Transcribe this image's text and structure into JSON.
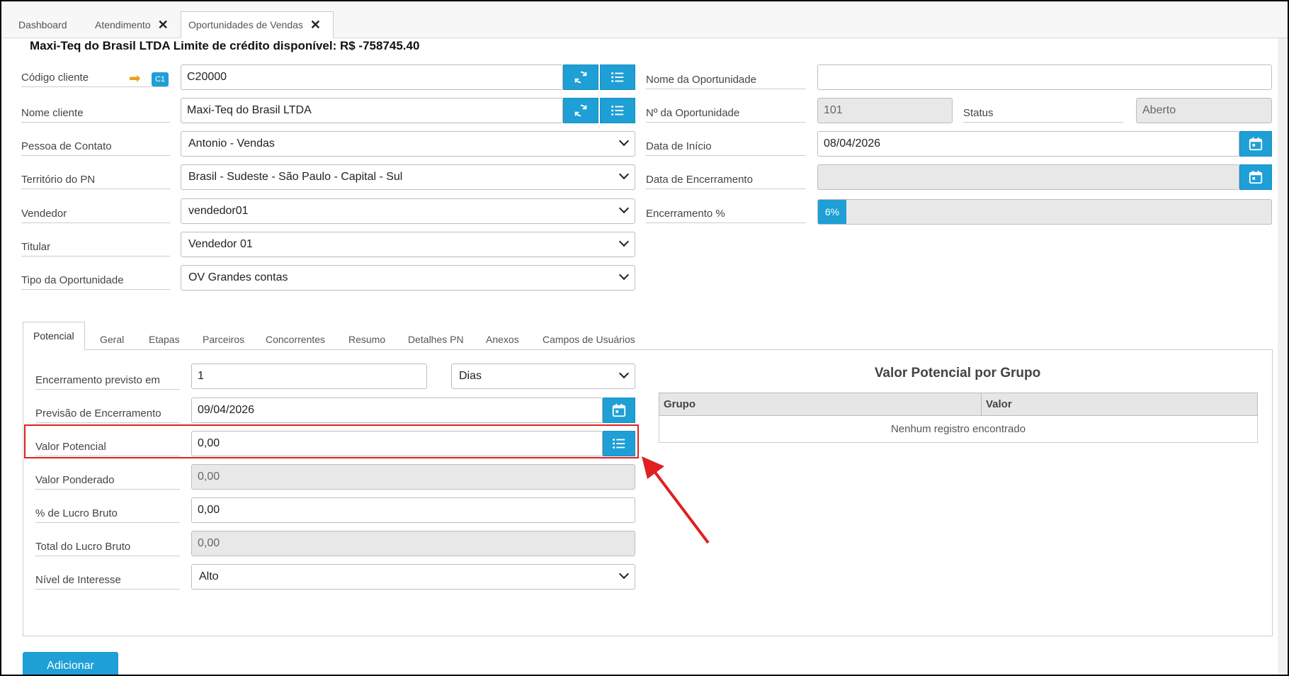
{
  "tabs": [
    {
      "label": "Dashboard"
    },
    {
      "label": "Atendimento"
    },
    {
      "label": "Oportunidades de Vendas"
    }
  ],
  "header": {
    "text": "Maxi-Teq do Brasil LTDA Limite de crédito disponível: R$ -758745.40"
  },
  "left_form": {
    "codigo_cliente": {
      "label": "Código cliente",
      "badge": "C1",
      "value": "C20000"
    },
    "nome_cliente": {
      "label": "Nome cliente",
      "value": "Maxi-Teq do Brasil LTDA"
    },
    "pessoa_contato": {
      "label": "Pessoa de Contato",
      "value": "Antonio - Vendas"
    },
    "territorio": {
      "label": "Território do PN",
      "value": "Brasil - Sudeste - São Paulo - Capital - Sul"
    },
    "vendedor": {
      "label": "Vendedor",
      "value": "vendedor01"
    },
    "titular": {
      "label": "Titular",
      "value": "Vendedor 01"
    },
    "tipo": {
      "label": "Tipo da Oportunidade",
      "value": "OV Grandes contas"
    }
  },
  "right_form": {
    "nome_oportunidade": {
      "label": "Nome da Oportunidade",
      "value": ""
    },
    "num_oportunidade": {
      "label": "Nº da Oportunidade",
      "value": "101"
    },
    "status": {
      "label": "Status",
      "value": "Aberto"
    },
    "data_inicio": {
      "label": "Data de Início",
      "value": "08/04/2026"
    },
    "data_encerramento": {
      "label": "Data de Encerramento",
      "value": ""
    },
    "encerramento_pct": {
      "label": "Encerramento %",
      "value": "6%",
      "fraction": 0.06
    }
  },
  "panel_tabs": [
    "Potencial",
    "Geral",
    "Etapas",
    "Parceiros",
    "Concorrentes",
    "Resumo",
    "Detalhes PN",
    "Anexos",
    "Campos de Usuários"
  ],
  "potencial": {
    "encerramento_previsto": {
      "label": "Encerramento previsto em",
      "value": "1",
      "unit": "Dias"
    },
    "previsao_encerramento": {
      "label": "Previsão de Encerramento",
      "value": "09/04/2026"
    },
    "valor_potencial": {
      "label": "Valor Potencial",
      "value": "0,00"
    },
    "valor_ponderado": {
      "label": "Valor Ponderado",
      "value": "0,00"
    },
    "lucro_bruto_pct": {
      "label": "% de Lucro Bruto",
      "value": "0,00"
    },
    "total_lucro_bruto": {
      "label": "Total do Lucro Bruto",
      "value": "0,00"
    },
    "nivel_interesse": {
      "label": "Nível de Interesse",
      "value": "Alto"
    }
  },
  "grupo_table": {
    "title": "Valor Potencial por Grupo",
    "columns": [
      "Grupo",
      "Valor"
    ],
    "empty": "Nenhum registro encontrado"
  },
  "add_button": "Adicionar",
  "colors": {
    "accent": "#1e9fd6",
    "highlight": "#e02020",
    "arrow": "#e8a020"
  }
}
